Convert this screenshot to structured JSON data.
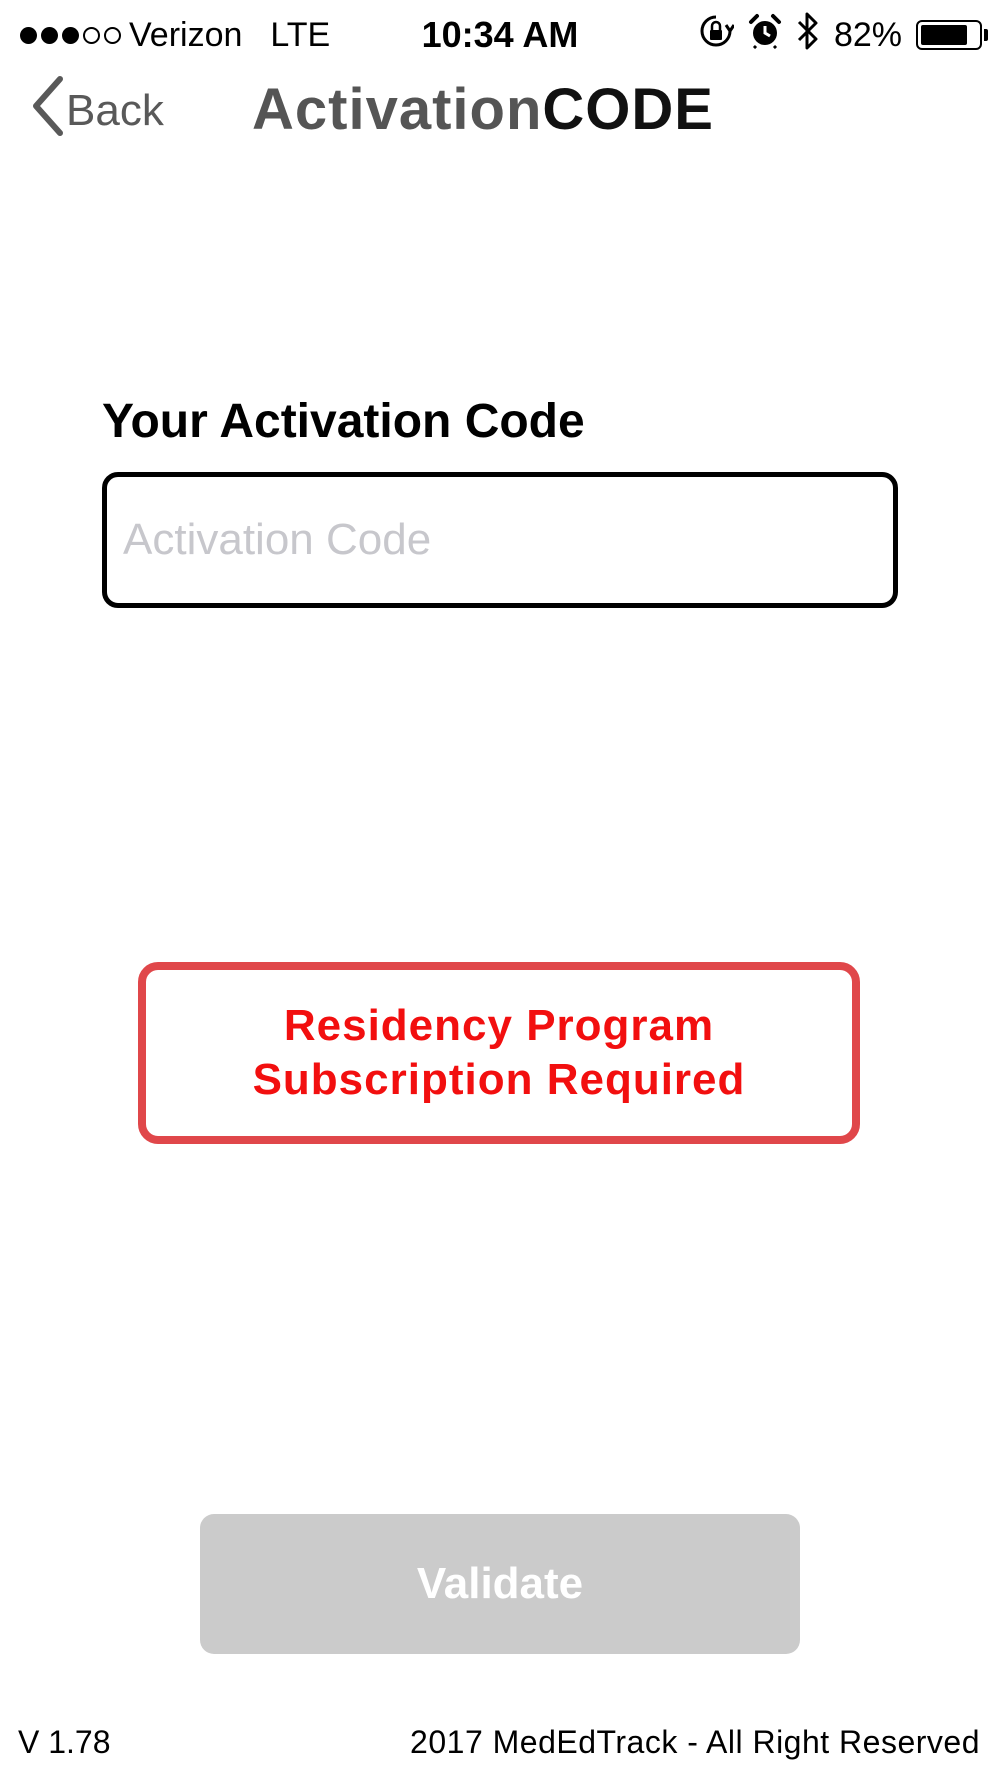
{
  "status_bar": {
    "signal_bars_filled": 3,
    "signal_bars_total": 5,
    "carrier": "Verizon",
    "network": "LTE",
    "time": "10:34 AM",
    "icons": [
      "orientation-lock-icon",
      "alarm-icon",
      "bluetooth-icon"
    ],
    "battery_percent": "82%",
    "battery_level": 0.82
  },
  "nav": {
    "back_label": "Back",
    "title_part1": "Activation",
    "title_part2": "CODE"
  },
  "form": {
    "label": "Your Activation Code",
    "input_value": "",
    "input_placeholder": "Activation Code"
  },
  "notice": {
    "line1": "Residency Program",
    "line2": "Subscription Required"
  },
  "validate_label": "Validate",
  "footer": {
    "version": "V 1.78",
    "copyright": "2017 MedEdTrack - All Right Reserved"
  },
  "colors": {
    "notice_border": "#e0474a",
    "notice_text": "#f20f0f",
    "validate_bg": "#cbcbcb",
    "placeholder": "#c7c7cc"
  }
}
